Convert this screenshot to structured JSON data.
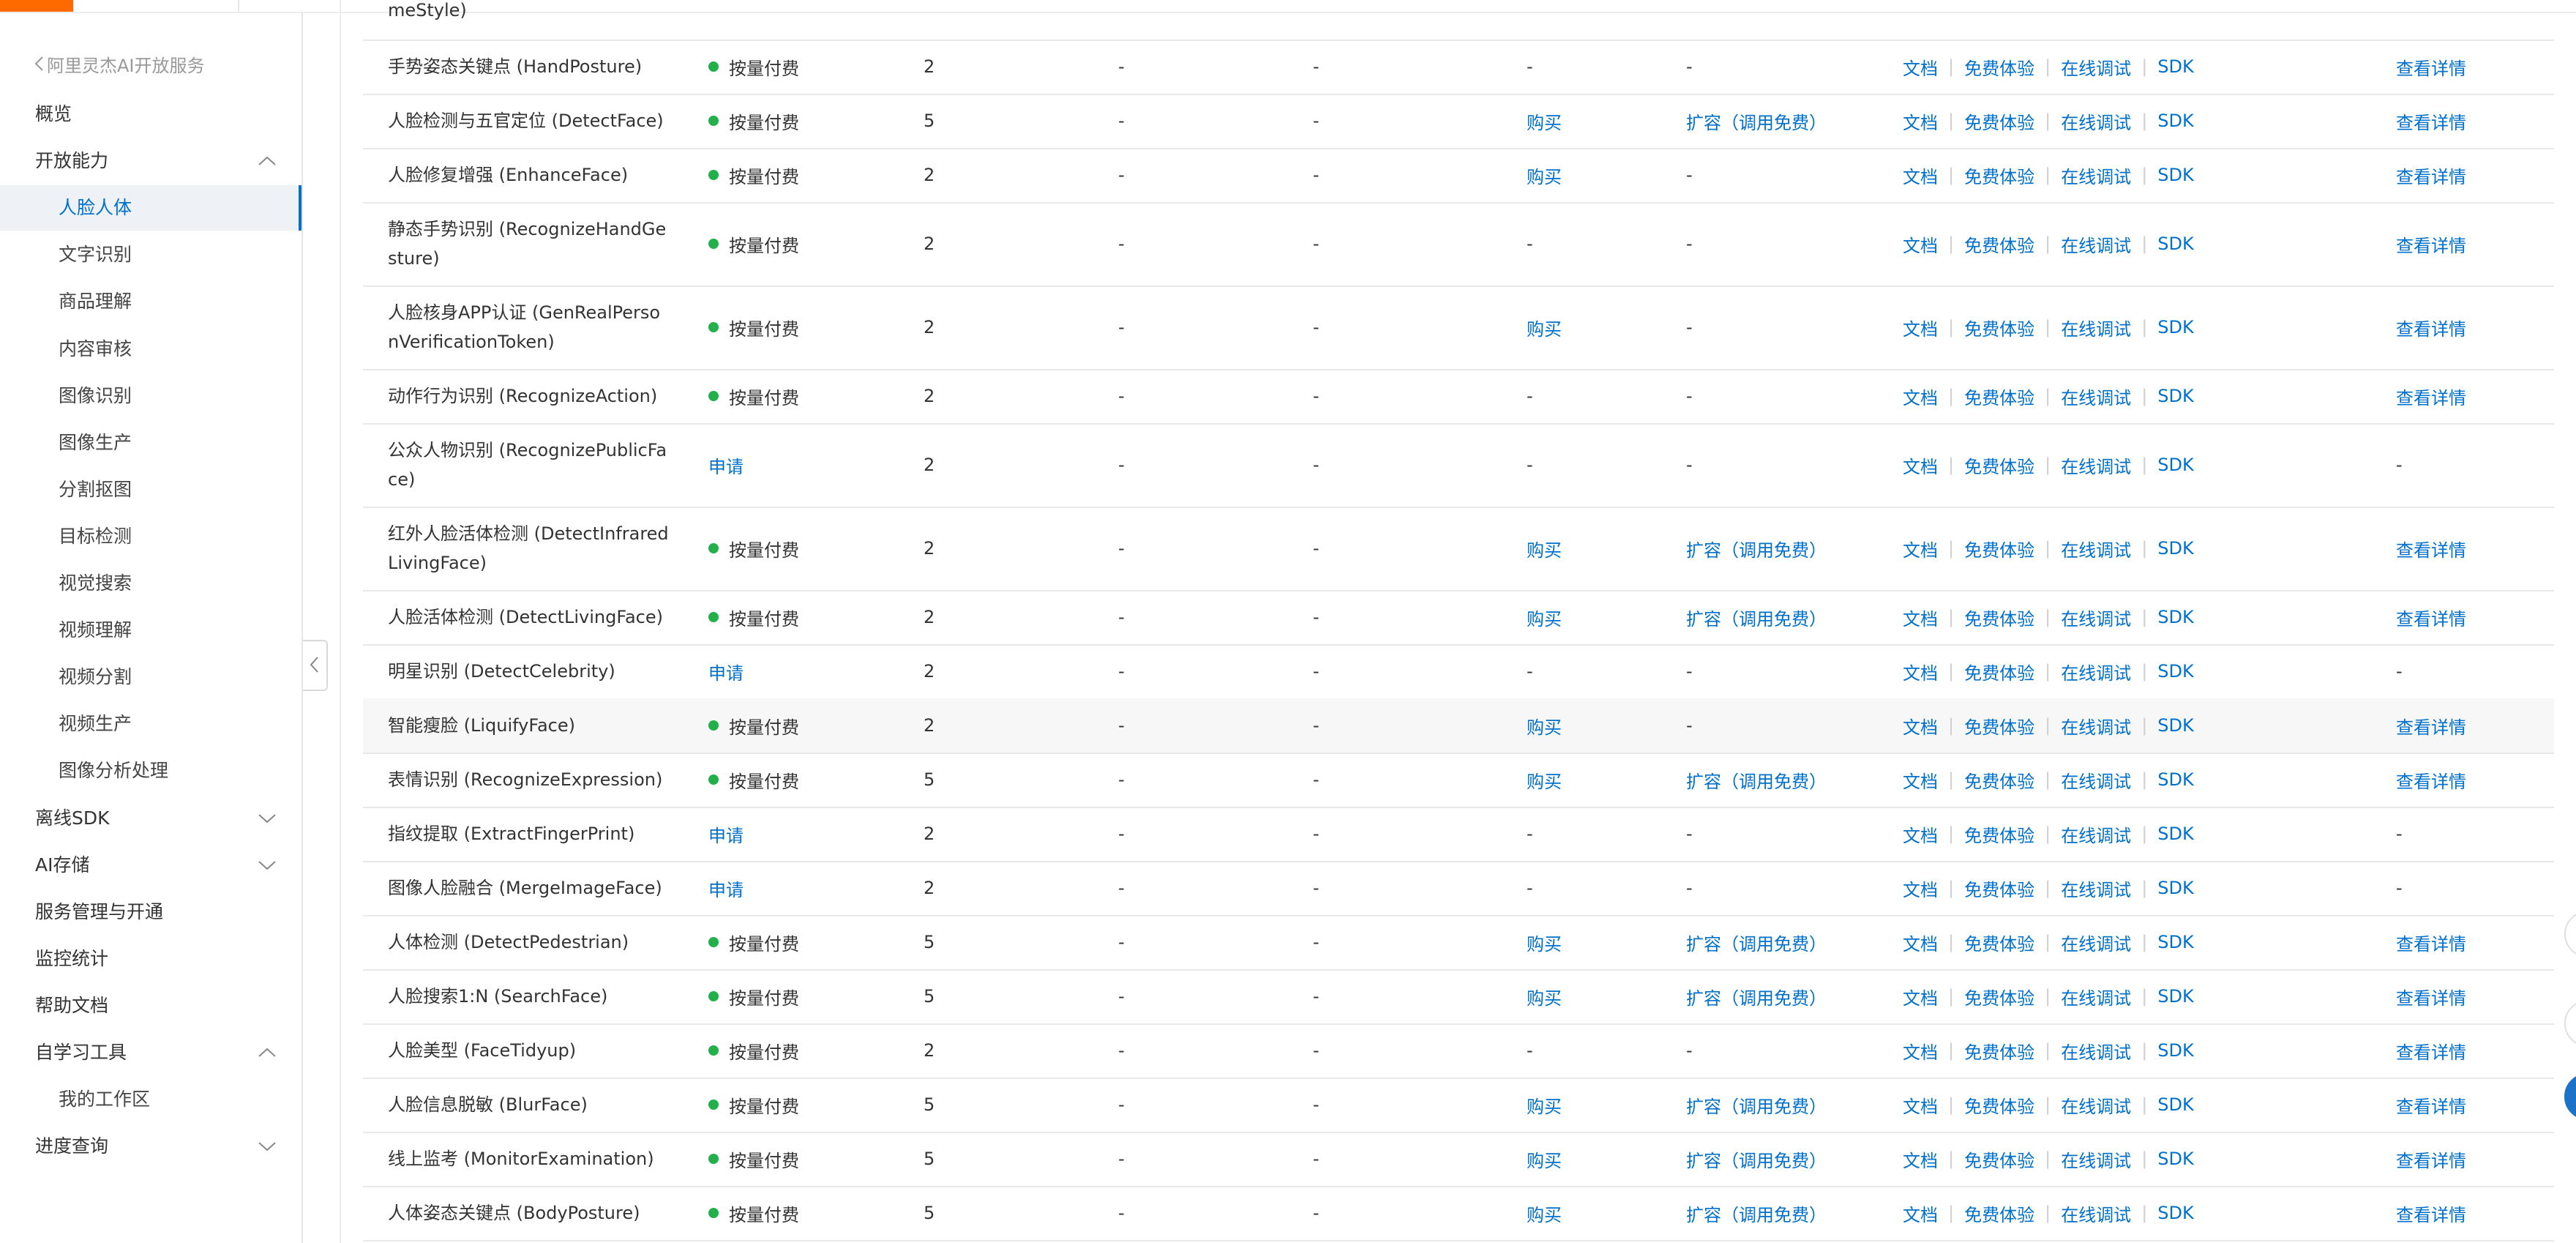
{
  "sidebar": {
    "back_label": "阿里灵杰AI开放服务",
    "items": [
      {
        "label": "概览",
        "level": 0,
        "arrow": ""
      },
      {
        "label": "开放能力",
        "level": 0,
        "arrow": "up"
      },
      {
        "label": "人脸人体",
        "level": 1,
        "arrow": "",
        "active": true
      },
      {
        "label": "文字识别",
        "level": 1,
        "arrow": ""
      },
      {
        "label": "商品理解",
        "level": 1,
        "arrow": ""
      },
      {
        "label": "内容审核",
        "level": 1,
        "arrow": ""
      },
      {
        "label": "图像识别",
        "level": 1,
        "arrow": ""
      },
      {
        "label": "图像生产",
        "level": 1,
        "arrow": ""
      },
      {
        "label": "分割抠图",
        "level": 1,
        "arrow": ""
      },
      {
        "label": "目标检测",
        "level": 1,
        "arrow": ""
      },
      {
        "label": "视觉搜索",
        "level": 1,
        "arrow": ""
      },
      {
        "label": "视频理解",
        "level": 1,
        "arrow": ""
      },
      {
        "label": "视频分割",
        "level": 1,
        "arrow": ""
      },
      {
        "label": "视频生产",
        "level": 1,
        "arrow": ""
      },
      {
        "label": "图像分析处理",
        "level": 1,
        "arrow": ""
      },
      {
        "label": "离线SDK",
        "level": 0,
        "arrow": "down"
      },
      {
        "label": "AI存储",
        "level": 0,
        "arrow": "down"
      },
      {
        "label": "服务管理与开通",
        "level": 0,
        "arrow": ""
      },
      {
        "label": "监控统计",
        "level": 0,
        "arrow": ""
      },
      {
        "label": "帮助文档",
        "level": 0,
        "arrow": ""
      },
      {
        "label": "自学习工具",
        "level": 0,
        "arrow": "up"
      },
      {
        "label": "我的工作区",
        "level": 1,
        "arrow": ""
      },
      {
        "label": "进度查询",
        "level": 0,
        "arrow": "down"
      }
    ]
  },
  "table": {
    "truncated_top_text": "meStyle)",
    "link_labels": {
      "doc": "文档",
      "trial": "免费体验",
      "debug": "在线调试",
      "sdk": "SDK"
    },
    "rows": [
      {
        "name": "手势姿态关键点 (HandPosture)",
        "status": "按量付费",
        "status_type": "paid",
        "qps": "2",
        "d1": "-",
        "d2": "-",
        "buy": "-",
        "expand": "-",
        "detail": "查看详情"
      },
      {
        "name": "人脸检测与五官定位 (DetectFace)",
        "status": "按量付费",
        "status_type": "paid",
        "qps": "5",
        "d1": "-",
        "d2": "-",
        "buy": "购买",
        "expand": "扩容（调用免费）",
        "detail": "查看详情"
      },
      {
        "name": "人脸修复增强 (EnhanceFace)",
        "status": "按量付费",
        "status_type": "paid",
        "qps": "2",
        "d1": "-",
        "d2": "-",
        "buy": "购买",
        "expand": "-",
        "detail": "查看详情"
      },
      {
        "name": "静态手势识别 (RecognizeHandGe|sture)",
        "status": "按量付费",
        "status_type": "paid",
        "qps": "2",
        "d1": "-",
        "d2": "-",
        "buy": "-",
        "expand": "-",
        "detail": "查看详情"
      },
      {
        "name": "人脸核身APP认证 (GenRealPerso|nVerificationToken)",
        "status": "按量付费",
        "status_type": "paid",
        "qps": "2",
        "d1": "-",
        "d2": "-",
        "buy": "购买",
        "expand": "-",
        "detail": "查看详情"
      },
      {
        "name": "动作行为识别 (RecognizeAction)",
        "status": "按量付费",
        "status_type": "paid",
        "qps": "2",
        "d1": "-",
        "d2": "-",
        "buy": "-",
        "expand": "-",
        "detail": "查看详情"
      },
      {
        "name": "公众人物识别 (RecognizePublicFa|ce)",
        "status": "申请",
        "status_type": "apply",
        "qps": "2",
        "d1": "-",
        "d2": "-",
        "buy": "-",
        "expand": "-",
        "detail": "-"
      },
      {
        "name": "红外人脸活体检测 (DetectInfrared|LivingFace)",
        "status": "按量付费",
        "status_type": "paid",
        "qps": "2",
        "d1": "-",
        "d2": "-",
        "buy": "购买",
        "expand": "扩容（调用免费）",
        "detail": "查看详情"
      },
      {
        "name": "人脸活体检测 (DetectLivingFace)",
        "status": "按量付费",
        "status_type": "paid",
        "qps": "2",
        "d1": "-",
        "d2": "-",
        "buy": "购买",
        "expand": "扩容（调用免费）",
        "detail": "查看详情"
      },
      {
        "name": "明星识别 (DetectCelebrity)",
        "status": "申请",
        "status_type": "apply",
        "qps": "2",
        "d1": "-",
        "d2": "-",
        "buy": "-",
        "expand": "-",
        "detail": "-"
      },
      {
        "name": "智能瘦脸 (LiquifyFace)",
        "status": "按量付费",
        "status_type": "paid",
        "qps": "2",
        "d1": "-",
        "d2": "-",
        "buy": "购买",
        "expand": "-",
        "detail": "查看详情"
      },
      {
        "name": "表情识别 (RecognizeExpression)",
        "status": "按量付费",
        "status_type": "paid",
        "qps": "5",
        "d1": "-",
        "d2": "-",
        "buy": "购买",
        "expand": "扩容（调用免费）",
        "detail": "查看详情"
      },
      {
        "name": "指纹提取 (ExtractFingerPrint)",
        "status": "申请",
        "status_type": "apply",
        "qps": "2",
        "d1": "-",
        "d2": "-",
        "buy": "-",
        "expand": "-",
        "detail": "-"
      },
      {
        "name": "图像人脸融合 (MergeImageFace)",
        "status": "申请",
        "status_type": "apply",
        "qps": "2",
        "d1": "-",
        "d2": "-",
        "buy": "-",
        "expand": "-",
        "detail": "-"
      },
      {
        "name": "人体检测 (DetectPedestrian)",
        "status": "按量付费",
        "status_type": "paid",
        "qps": "5",
        "d1": "-",
        "d2": "-",
        "buy": "购买",
        "expand": "扩容（调用免费）",
        "detail": "查看详情"
      },
      {
        "name": "人脸搜索1:N (SearchFace)",
        "status": "按量付费",
        "status_type": "paid",
        "qps": "5",
        "d1": "-",
        "d2": "-",
        "buy": "购买",
        "expand": "扩容（调用免费）",
        "detail": "查看详情"
      },
      {
        "name": "人脸美型 (FaceTidyup)",
        "status": "按量付费",
        "status_type": "paid",
        "qps": "2",
        "d1": "-",
        "d2": "-",
        "buy": "-",
        "expand": "-",
        "detail": "查看详情"
      },
      {
        "name": "人脸信息脱敏 (BlurFace)",
        "status": "按量付费",
        "status_type": "paid",
        "qps": "5",
        "d1": "-",
        "d2": "-",
        "buy": "购买",
        "expand": "扩容（调用免费）",
        "detail": "查看详情"
      },
      {
        "name": "线上监考 (MonitorExamination)",
        "status": "按量付费",
        "status_type": "paid",
        "qps": "5",
        "d1": "-",
        "d2": "-",
        "buy": "购买",
        "expand": "扩容（调用免费）",
        "detail": "查看详情"
      },
      {
        "name": "人体姿态关键点 (BodyPosture)",
        "status": "按量付费",
        "status_type": "paid",
        "qps": "5",
        "d1": "-",
        "d2": "-",
        "buy": "购买",
        "expand": "扩容（调用免费）",
        "detail": "查看详情"
      }
    ]
  },
  "colors": {
    "link": "#0070cc",
    "status_dot": "#23b04a",
    "brand": "#ff6a00",
    "active_bg": "#eef1f6"
  }
}
